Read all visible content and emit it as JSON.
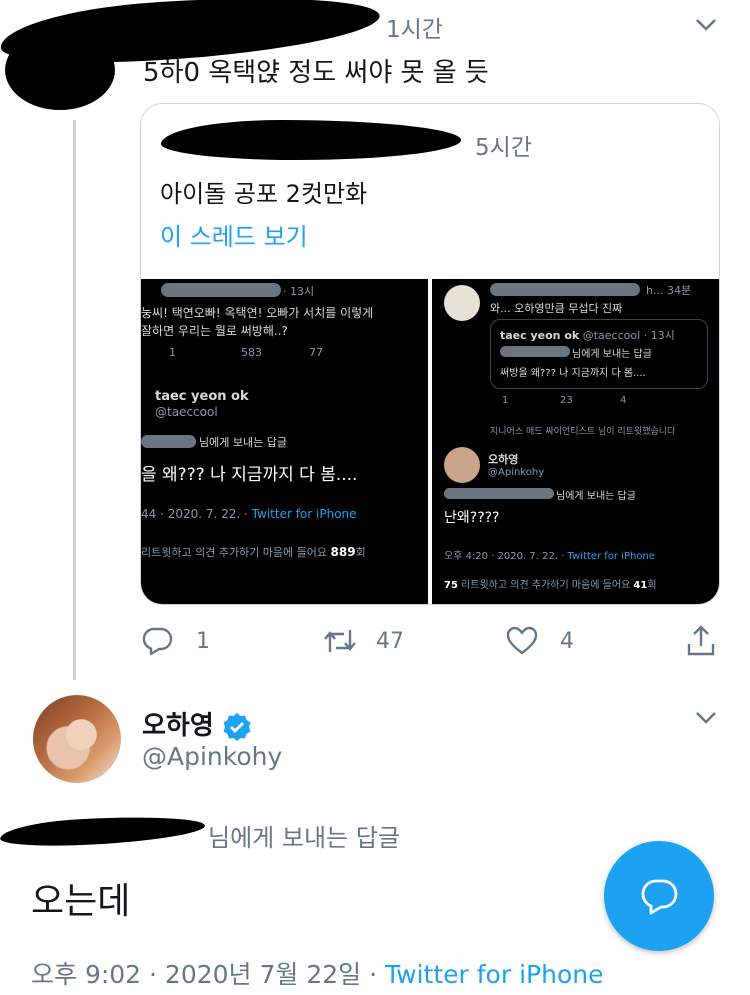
{
  "reply_tweet": {
    "time": "1시간",
    "text": "5하0 옥택얁 정도 써야 못 올 듯"
  },
  "quoted_tweet": {
    "time": "5시간",
    "text": "아이돌 공포 2컷만화",
    "thread_link": "이 스레드 보기",
    "image_left": {
      "time": "· 13시",
      "tweet1_text_line1": "눙씨! 택연오빠! 옥택연! 오빠가 서치를 이렇게",
      "tweet1_text_line2": "잘하면 우리는 뭘로 써방해..?",
      "tweet1_replies": "1",
      "tweet1_retweets": "583",
      "tweet1_likes": "77",
      "tweet2_name": "taec yeon ok",
      "tweet2_handle": "@taeccool",
      "tweet2_reply_to": "님에게 보내는 답글",
      "tweet2_text": "을 왜??? 나 지금까지 다 봄....",
      "tweet2_meta": "44 · 2020. 7. 22. · ",
      "tweet2_source": "Twitter for iPhone",
      "tweet2_stats": "리트윗하고 의견 추가하기  마음에 들어요 ",
      "tweet2_stats_num": "889",
      "tweet2_stats_unit": "회"
    },
    "image_right": {
      "time": "h... 34분",
      "tweet1_text": "와... 오하영만큼 무섭다 진짜",
      "inner_name": "taec yeon ok",
      "inner_handle": "@taeccool · 13시",
      "inner_reply_to": "님에게 보내는 답글",
      "inner_text": "써방을 왜??? 나 지금까지 다 봄....",
      "tweet1_replies": "1",
      "tweet1_retweets": "23",
      "tweet1_likes": "4",
      "retweeted_note": "지니어스 매드 싸이언티스트 님이 리트윗했습니다",
      "tweet2_name": "오하영",
      "tweet2_handle": "@Apinkohy",
      "tweet2_reply_to": "님에게 보내는 답글",
      "tweet2_text": "난왜????",
      "tweet2_meta": "오후 4:20 · 2020. 7. 22. · ",
      "tweet2_source": "Twitter for iPhone",
      "tweet2_stats_num": "75",
      "tweet2_stats": " 리트윗하고 의견 추가하기  마음에 들어요 ",
      "tweet2_stats_num2": "41",
      "tweet2_stats_unit": "회"
    }
  },
  "reply_actions": {
    "replies": "1",
    "retweets": "47",
    "likes": "4"
  },
  "main_tweet": {
    "name": "오하영",
    "handle": "@Apinkohy",
    "reply_to": "님에게 보내는 답글",
    "text": "오는데",
    "meta": "오후 9:02 · 2020년 7월 22일 · ",
    "source": "Twitter for iPhone"
  },
  "colors": {
    "accent": "#1da1f2",
    "gray": "#657786",
    "border": "#ccd6dd"
  }
}
